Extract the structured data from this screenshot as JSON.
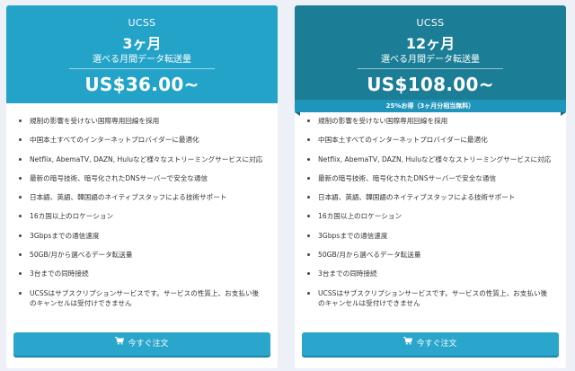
{
  "plans": [
    {
      "product": "UCSS",
      "term": "3ヶ月",
      "subtitle": "選べる月間データ転送量",
      "price": "US$36.00~",
      "badge": "",
      "features": [
        "規制の影響を受けない国際専用回線を採用",
        "中国本土すべてのインターネットプロバイダーに最適化",
        "Netflix, AbemaTV, DAZN, Huluなど様々なストリーミングサービスに対応",
        "最新の暗号技術、暗号化されたDNSサーバーで安全な通信",
        "日本語、英語、韓国語のネイティブスタッフによる技術サポート",
        "16カ国以上のロケーション",
        "3Gbpsまでの通信速度",
        "50GB/月から選べるデータ転送量",
        "3台までの同時接続",
        "UCSSはサブスクリプションサービスです。サービスの性質上、お支払い後のキャンセルは受付けできません"
      ],
      "order_label": "今すぐ注文",
      "header_color": "#24a3c9"
    },
    {
      "product": "UCSS",
      "term": "12ヶ月",
      "subtitle": "選べる月間データ転送量",
      "price": "US$108.00~",
      "badge": "25%お得（3ヶ月分相当無料）",
      "features": [
        "規制の影響を受けない国際専用回線を採用",
        "中国本土すべてのインターネットプロバイダーに最適化",
        "Netflix, AbemaTV, DAZN, Huluなど様々なストリーミングサービスに対応",
        "最新の暗号技術、暗号化されたDNSサーバーで安全な通信",
        "日本語、英語、韓国語のネイティブスタッフによる技術サポート",
        "16カ国以上のロケーション",
        "3Gbpsまでの通信速度",
        "50GB/月から選べるデータ転送量",
        "3台までの同時接続",
        "UCSSはサブスクリプションサービスです。サービスの性質上、お支払い後のキャンセルは受付けできません"
      ],
      "order_label": "今すぐ注文",
      "header_color": "#1b7e96"
    }
  ],
  "icons": {
    "order": "shopping-cart-icon"
  },
  "colors": {
    "button": "#2aa5cb",
    "ribbon": "#1f95bb"
  }
}
